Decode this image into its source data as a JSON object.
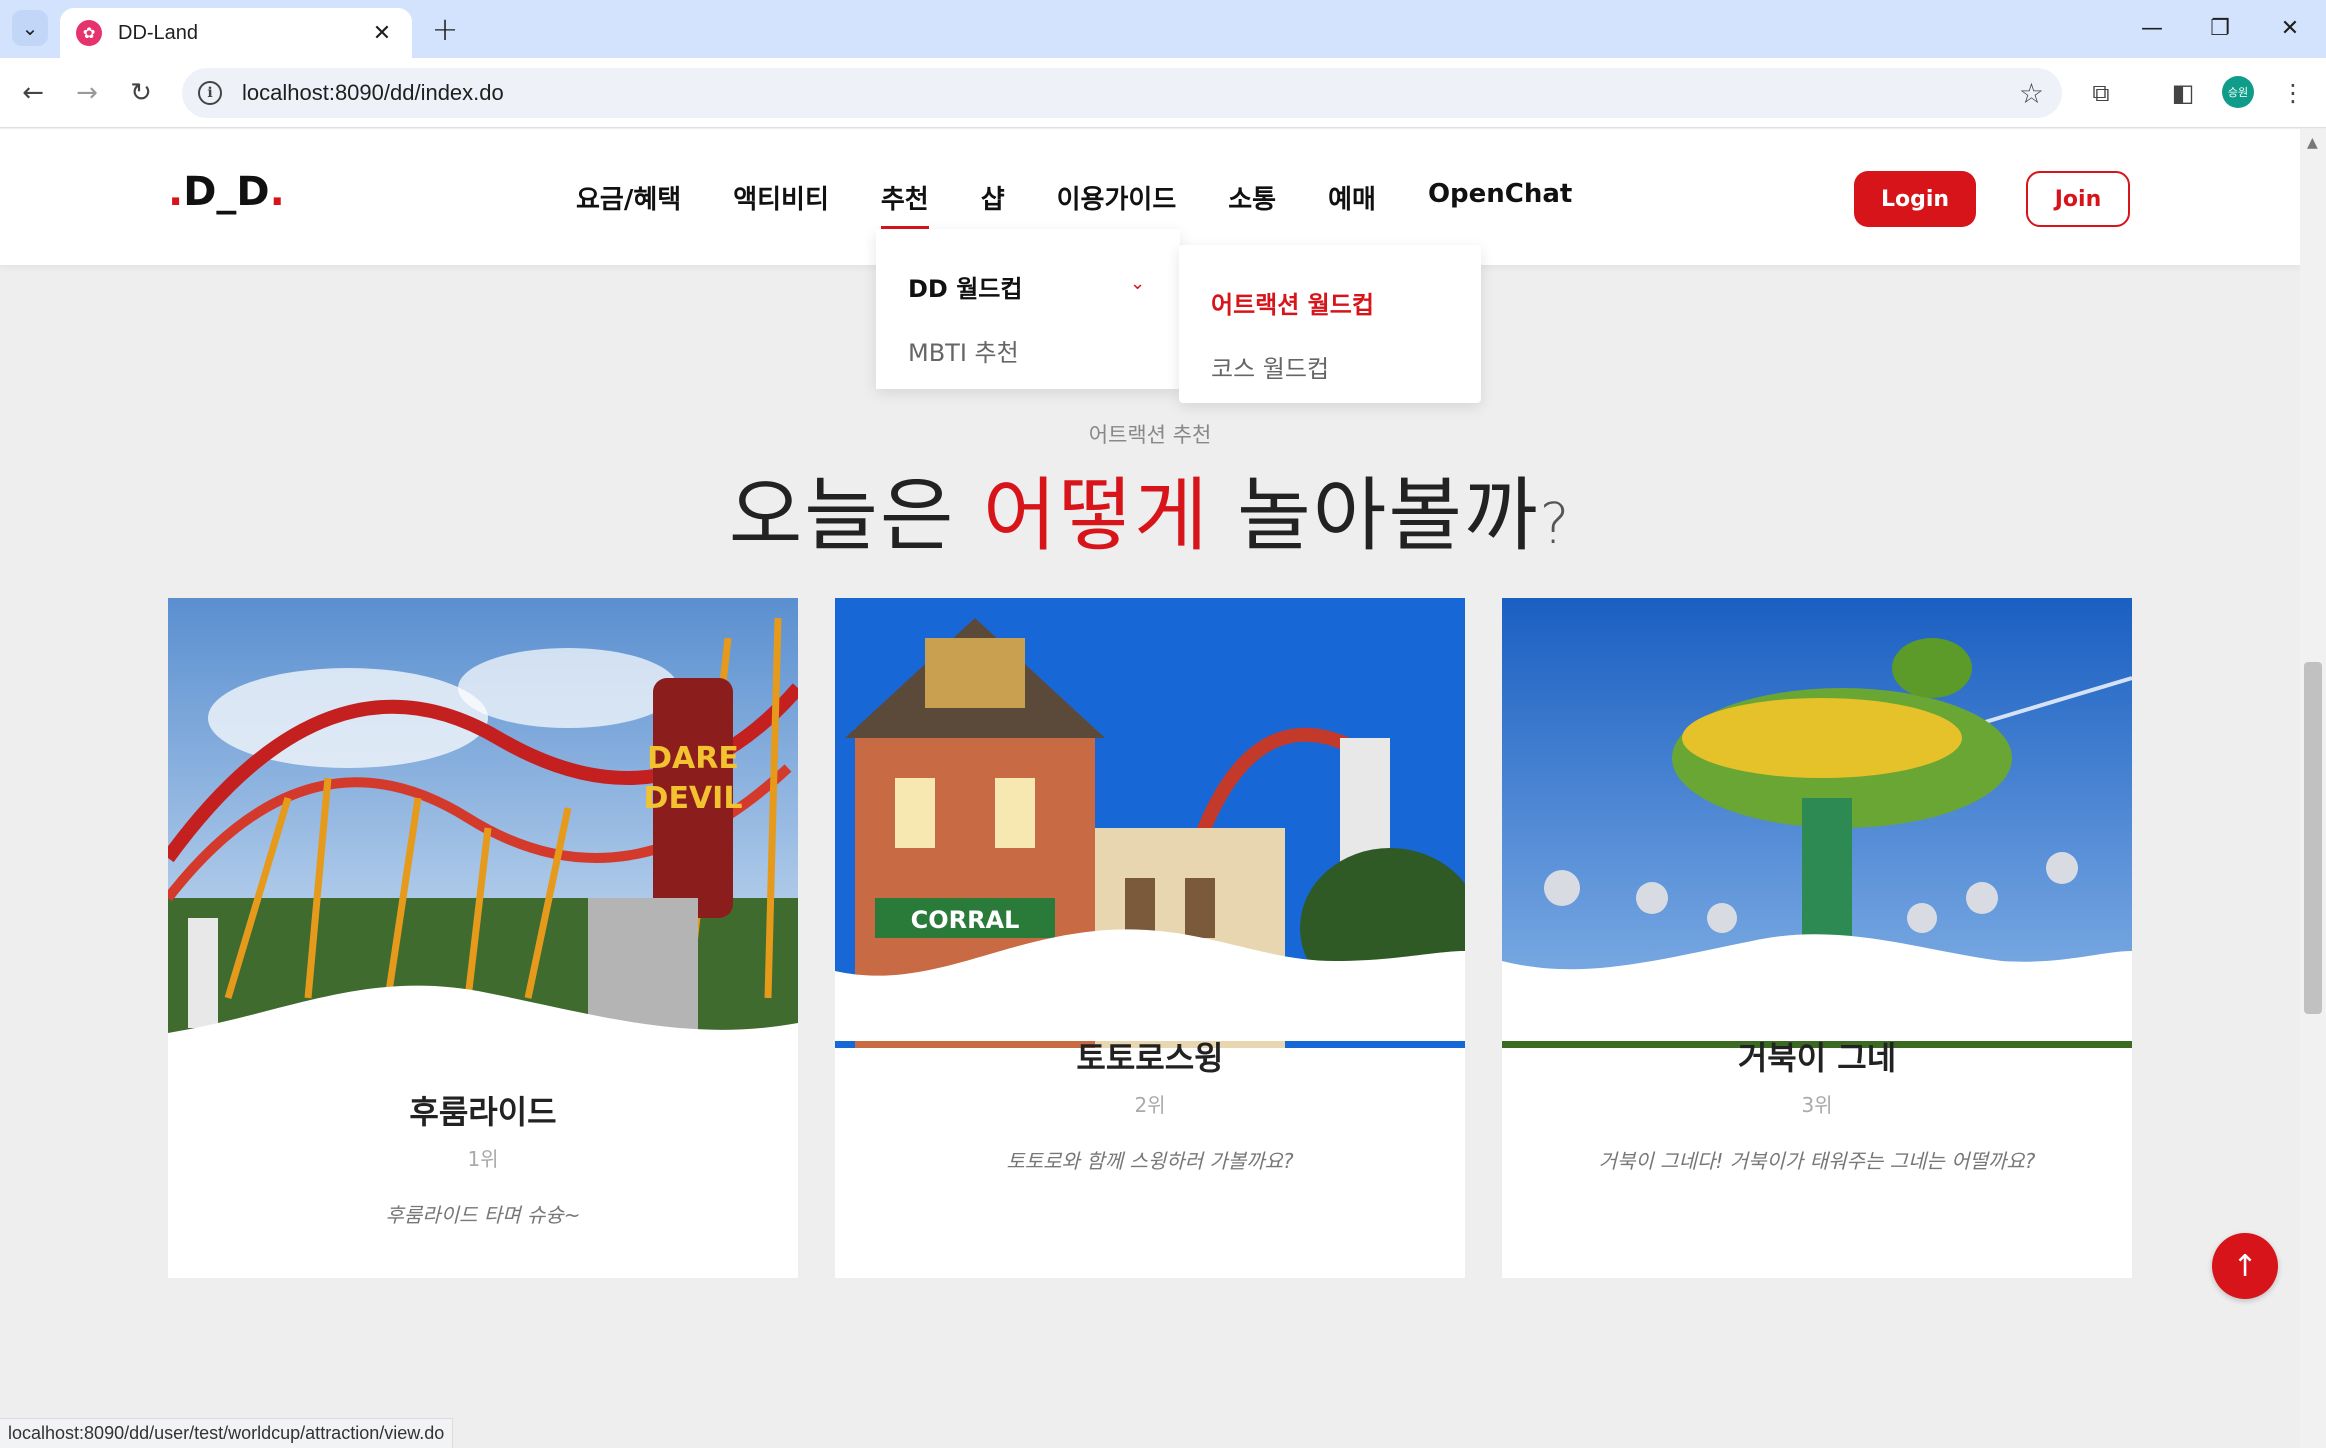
{
  "browser": {
    "tab_title": "DD-Land",
    "tab_favicon": "✿",
    "url": "localhost:8090/dd/index.do",
    "profile_label": "승원",
    "status_url": "localhost:8090/dd/user/test/worldcup/attraction/view.do"
  },
  "header": {
    "logo_main": "D_D",
    "nav": [
      "요금/혜택",
      "액티비티",
      "추천",
      "샵",
      "이용가이드",
      "소통",
      "예매",
      "OpenChat"
    ],
    "active_nav_index": 2,
    "login_label": "Login",
    "join_label": "Join"
  },
  "dropdown": {
    "items": [
      "DD 월드컵",
      "MBTI 추천"
    ],
    "submenu": [
      "어트랙션 월드컵",
      "코스 월드컵"
    ]
  },
  "section": {
    "label": "어트랙션 추천",
    "title_before": "오늘은 ",
    "title_highlight": "어떻게",
    "title_after": " 놀아볼까",
    "title_mark": "?"
  },
  "cards": [
    {
      "name": "후룸라이드",
      "rank": "1위",
      "desc": "후룸라이드 타며 슈슝~"
    },
    {
      "name": "토토로스윙",
      "rank": "2위",
      "desc": "토토로와 함께 스윙하러 가볼까요?"
    },
    {
      "name": "거북이 그네",
      "rank": "3위",
      "desc": "거북이 그네다! 거북이가 태워주는 그네는 어떨까요?"
    }
  ],
  "colors": {
    "accent": "#d7141a",
    "browser_frame": "#d3e3fd",
    "page_bg": "#eeeeee"
  },
  "icons": {
    "back": "back-arrow-icon",
    "forward": "forward-arrow-icon",
    "reload": "reload-icon",
    "top": "arrow-up-icon"
  }
}
